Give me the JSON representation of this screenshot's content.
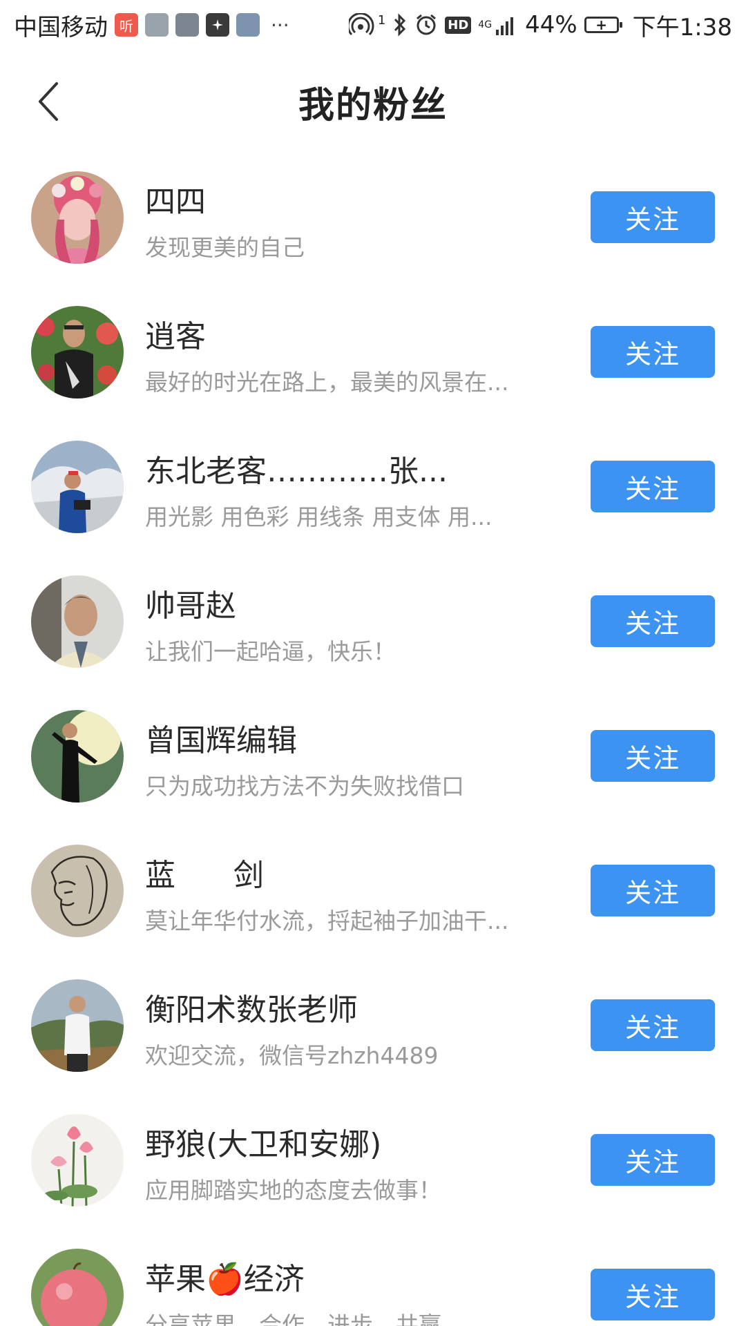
{
  "status_bar": {
    "carrier": "中国移动",
    "app_icons": [
      {
        "name": "ting-app-icon",
        "glyph": "听",
        "style": "red"
      },
      {
        "name": "notification-app-icon",
        "glyph": "",
        "style": "gray1"
      },
      {
        "name": "notification-app-icon",
        "glyph": "",
        "style": "gray2"
      },
      {
        "name": "huawei-app-icon",
        "glyph": "",
        "style": "dark"
      },
      {
        "name": "notification-app-icon",
        "glyph": "",
        "style": "blue"
      }
    ],
    "more": "···",
    "hotspot_badge": "1",
    "hd_label": "HD",
    "network": "4G",
    "battery_percent": "44%",
    "time": "下午1:38"
  },
  "header": {
    "title": "我的粉丝"
  },
  "follow_label": "关注",
  "fans": [
    {
      "name": "四四",
      "bio": "发现更美的自己"
    },
    {
      "name": "逍客",
      "bio": "最好的时光在路上，最美的风景在..."
    },
    {
      "name": "东北老客…………张...",
      "bio": "用光影 用色彩  用线条  用支体  用..."
    },
    {
      "name": "帅哥赵",
      "bio": "让我们一起哈逼，快乐！"
    },
    {
      "name": "曾国辉编辑",
      "bio": "只为成功找方法不为失败找借口"
    },
    {
      "name": "蓝      剑",
      "bio": "莫让年华付水流，捋起袖子加油干..."
    },
    {
      "name": "衡阳术数张老师",
      "bio": "欢迎交流，微信号zhzh4489"
    },
    {
      "name": "野狼(大卫和安娜)",
      "bio": "应用脚踏实地的态度去做事！"
    },
    {
      "name": "苹果🍎经济",
      "bio": "分享苹果、合作、进步、共赢"
    }
  ],
  "colors": {
    "accent": "#3d93f1",
    "bio_text": "#9a9a9a",
    "name_text": "#2a2a2a"
  }
}
